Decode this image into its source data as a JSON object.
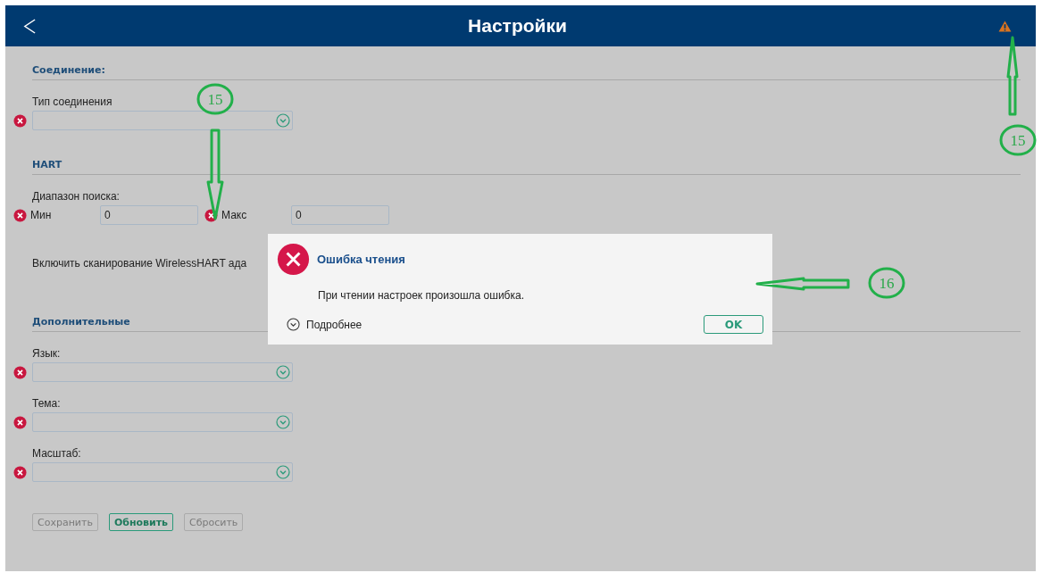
{
  "header": {
    "title": "Настройки"
  },
  "sections": [
    {
      "heading": "Соединение:",
      "fields": [
        {
          "kind": "select",
          "label": "Тип соединения",
          "error": true
        }
      ]
    },
    {
      "heading": "HART",
      "fields": [
        {
          "kind": "range",
          "label": "Диапазон поиска:",
          "inputs": [
            {
              "label": "Мин",
              "value": "0",
              "error": true
            },
            {
              "label": "Макс",
              "value": "0",
              "error": true
            }
          ]
        },
        {
          "kind": "text",
          "label": "Включить сканирование WirelessHART ада"
        }
      ]
    },
    {
      "heading": "Дополнительные",
      "fields": [
        {
          "kind": "select",
          "label": "Язык:",
          "error": true
        },
        {
          "kind": "select",
          "label": "Тема:",
          "error": true
        },
        {
          "kind": "select",
          "label": "Масштаб:",
          "error": true
        }
      ]
    }
  ],
  "buttons": [
    {
      "label": "Сохранить",
      "disabled": true
    },
    {
      "label": "Обновить",
      "disabled": false
    },
    {
      "label": "Сбросить",
      "disabled": true
    }
  ],
  "dialog": {
    "title": "Ошибка чтения",
    "message": "При чтении настроек произошла ошибка.",
    "details": "Подробнее",
    "ok": "OK"
  },
  "annotations": [
    {
      "number": "15"
    },
    {
      "number": "15"
    },
    {
      "number": "16"
    }
  ]
}
